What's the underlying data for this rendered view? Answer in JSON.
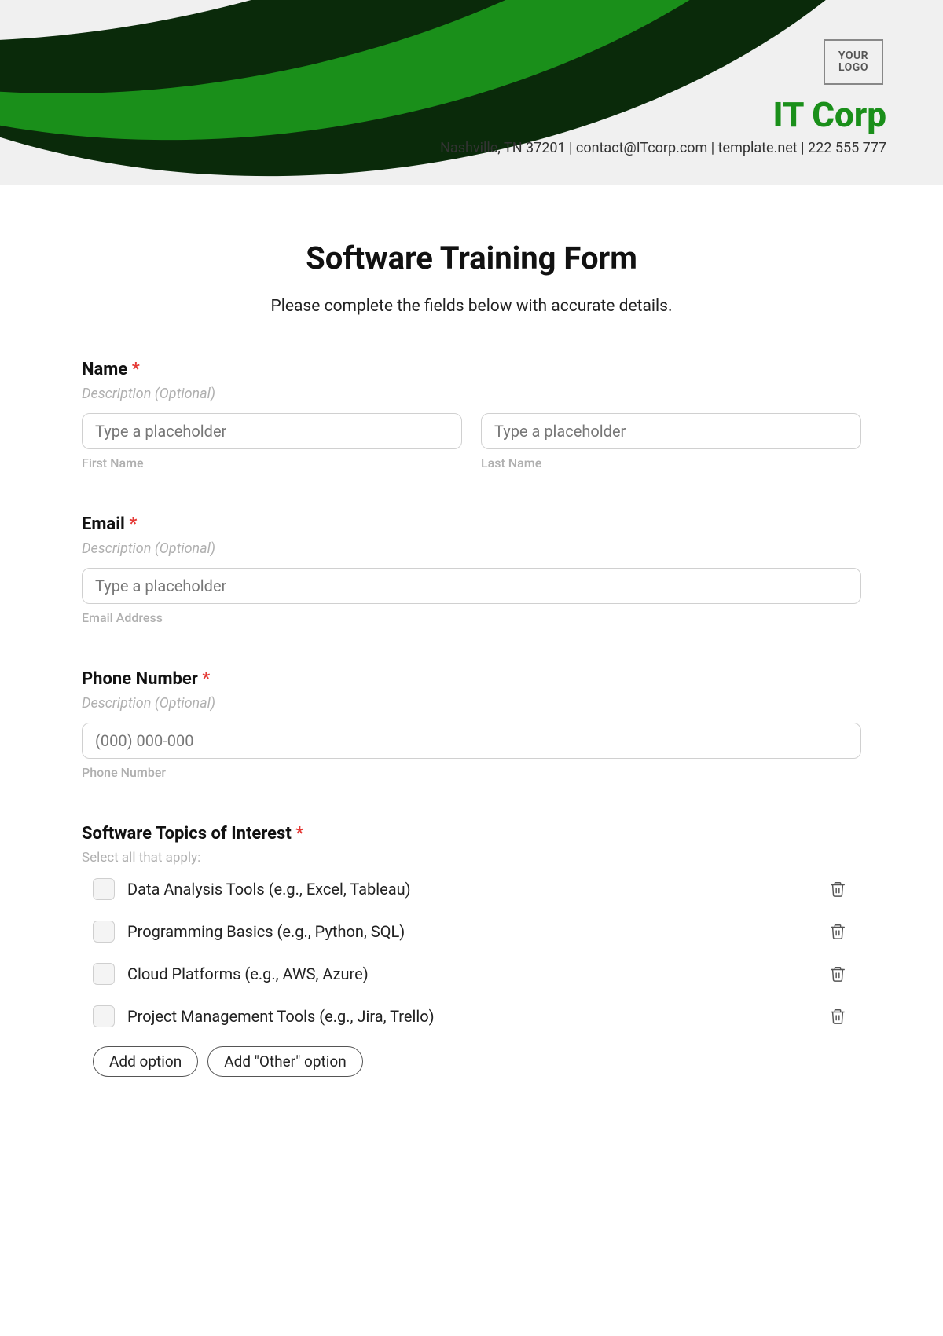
{
  "header": {
    "logo_text": "YOUR\nLOGO",
    "company_name": "IT Corp",
    "contact_line": "Nashville, TN 37201 | contact@ITcorp.com | template.net | 222 555 777"
  },
  "form": {
    "title": "Software Training Form",
    "intro": "Please complete the fields below with accurate details.",
    "name": {
      "label": "Name",
      "required_mark": "*",
      "description": "Description (Optional)",
      "first_placeholder": "Type a placeholder",
      "first_sublabel": "First Name",
      "last_placeholder": "Type a placeholder",
      "last_sublabel": "Last Name"
    },
    "email": {
      "label": "Email",
      "required_mark": "*",
      "description": "Description (Optional)",
      "placeholder": "Type a placeholder",
      "sublabel": "Email Address"
    },
    "phone": {
      "label": "Phone Number",
      "required_mark": "*",
      "description": "Description (Optional)",
      "placeholder": "(000) 000-000",
      "sublabel": "Phone Number"
    },
    "topics": {
      "label": "Software Topics of Interest",
      "required_mark": "*",
      "description": "Select all that apply:",
      "options": [
        "Data Analysis Tools (e.g., Excel, Tableau)",
        "Programming Basics (e.g., Python, SQL)",
        "Cloud Platforms (e.g., AWS, Azure)",
        "Project Management Tools (e.g., Jira, Trello)"
      ],
      "add_option_label": "Add option",
      "add_other_label": "Add \"Other\" option"
    }
  }
}
